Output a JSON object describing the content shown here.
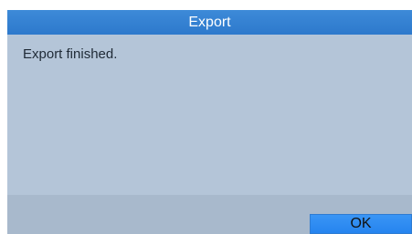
{
  "dialog": {
    "title": "Export",
    "message": "Export finished.",
    "ok_label": "OK"
  },
  "colors": {
    "title_bar": "#2d79cc",
    "content_background": "#b4c5d8",
    "footer_background": "#a8b9cc",
    "primary_button": "#2584ef"
  }
}
